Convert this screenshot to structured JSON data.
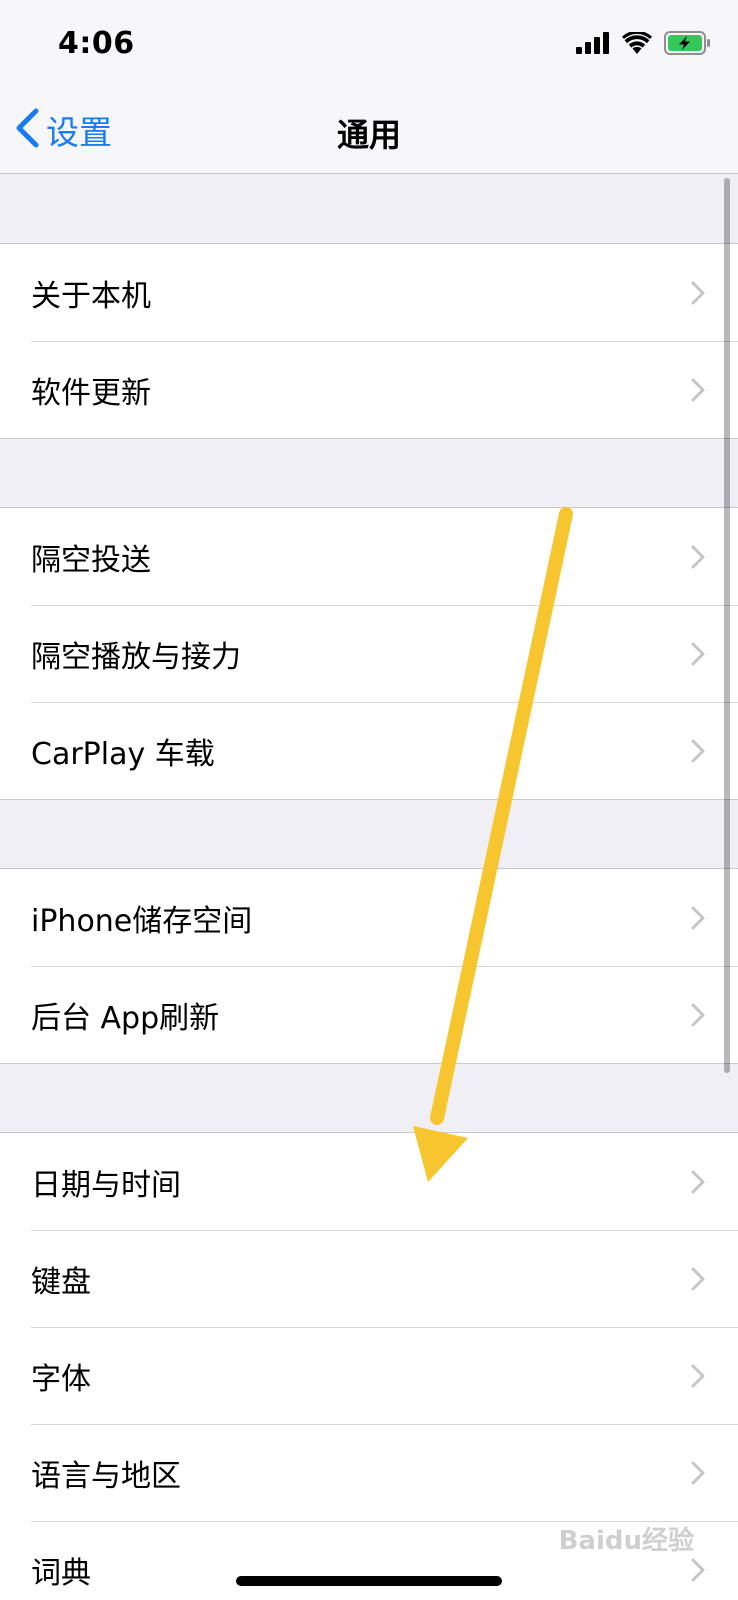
{
  "status_bar": {
    "time": "4:06",
    "icons": [
      "cellular-signal-icon",
      "wifi-icon",
      "battery-charging-icon"
    ]
  },
  "nav": {
    "back_label": "设置",
    "title": "通用"
  },
  "groups": [
    {
      "items": [
        {
          "label": "关于本机"
        },
        {
          "label": "软件更新"
        }
      ]
    },
    {
      "items": [
        {
          "label": "隔空投送"
        },
        {
          "label": "隔空播放与接力"
        },
        {
          "label": "CarPlay 车载"
        }
      ]
    },
    {
      "items": [
        {
          "label": "iPhone储存空间"
        },
        {
          "label": "后台 App刷新"
        }
      ]
    },
    {
      "items": [
        {
          "label": "日期与时间"
        },
        {
          "label": "键盘"
        },
        {
          "label": "字体"
        },
        {
          "label": "语言与地区"
        },
        {
          "label": "词典"
        }
      ]
    }
  ],
  "watermark": {
    "text": "Baidu经验"
  },
  "colors": {
    "accent": "#1a7cf5",
    "annotation_arrow": "#f7c52e",
    "battery_fill": "#34c759"
  }
}
